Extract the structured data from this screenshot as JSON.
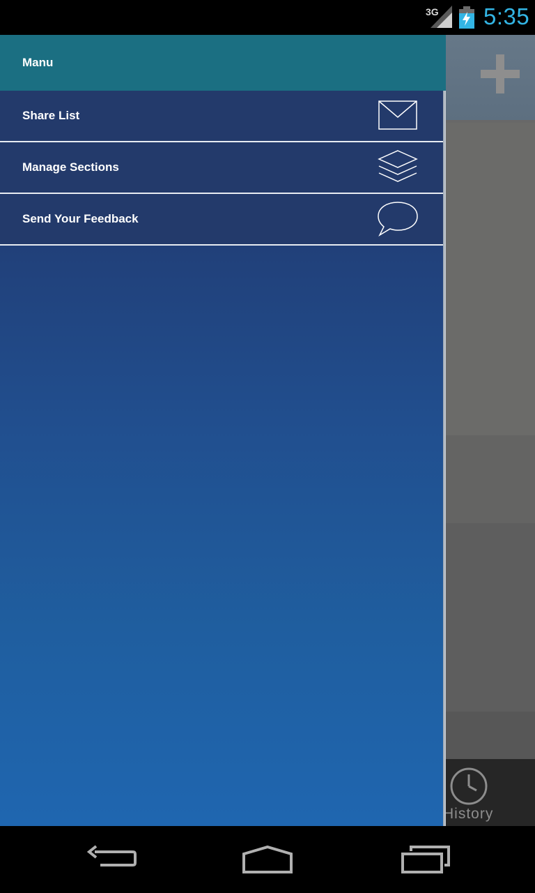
{
  "status_bar": {
    "network": "3G",
    "time": "5:35",
    "colors": {
      "time": "#33b5e5",
      "battery": "#33b5e5"
    },
    "icons": [
      "signal-icon",
      "battery-charging-icon"
    ]
  },
  "background_app": {
    "header_action_icon": "add-icon",
    "bottom_tab": {
      "label": "History",
      "icon": "clock-icon"
    }
  },
  "drawer": {
    "title": "Manu",
    "header_color": "#1b6f82",
    "items": [
      {
        "label": "Share List",
        "icon": "envelope-icon"
      },
      {
        "label": "Manage Sections",
        "icon": "layers-icon"
      },
      {
        "label": "Send Your Feedback",
        "icon": "speech-bubble-icon"
      }
    ]
  },
  "nav_bar": {
    "buttons": [
      "back-icon",
      "home-icon",
      "recent-apps-icon"
    ]
  }
}
